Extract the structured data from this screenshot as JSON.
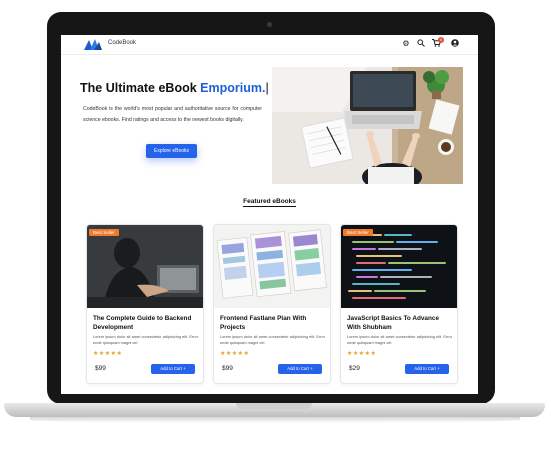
{
  "nav": {
    "brand": "CodeBook",
    "cart_count": "0"
  },
  "hero": {
    "title_main": "The Ultimate eBook ",
    "title_accent": "Emporium.",
    "cursor": "|",
    "description": "CodeBook is the world's most popular and authoritative source for computer science ebooks. Find ratings and access to the newest books digitally.",
    "button": "Explore eBooks"
  },
  "featured": {
    "title": "Featured eBooks",
    "books": [
      {
        "badge": "Best Seller",
        "title": "The Complete Guide to Backend Development",
        "desc": "Lorem ipsum dolor sit amet consectetur adipisicing elit. Error unde quisquam magni vel.",
        "stars": "★★★★★",
        "price": "$99",
        "button": "Add to Cart"
      },
      {
        "badge": "",
        "title": "Frontend Fastlane Plan With Projects",
        "desc": "Lorem ipsum dolor sit amet consectetur adipisicing elit. Error unde quisquam magni vel.",
        "stars": "★★★★★",
        "price": "$99",
        "button": "Add to Cart"
      },
      {
        "badge": "Best Seller",
        "title": "JavaScript Basics To Advance With Shubham",
        "desc": "Lorem ipsum dolor sit amet consectetur adipisicing elit. Error unde quisquam magni vel.",
        "stars": "★★★★★",
        "price": "$29",
        "button": "Add to Cart"
      }
    ]
  },
  "colors": {
    "accent": "#2563eb",
    "badge": "#f07a2b",
    "star": "#e4a11b"
  }
}
